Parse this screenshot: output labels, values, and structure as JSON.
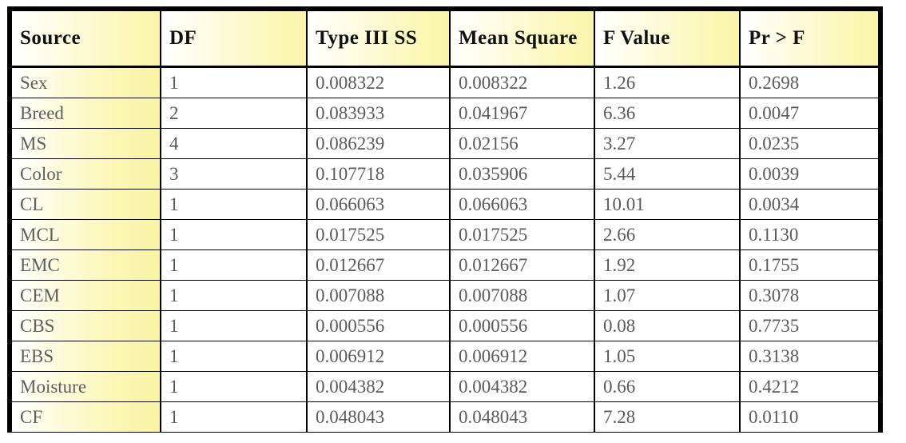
{
  "table": {
    "name": "anova-type-iii-table",
    "columns": [
      {
        "key": "source",
        "label": "Source"
      },
      {
        "key": "df",
        "label": "DF"
      },
      {
        "key": "ss",
        "label": "Type III SS"
      },
      {
        "key": "ms",
        "label": "Mean Square"
      },
      {
        "key": "f",
        "label": "F Value"
      },
      {
        "key": "p",
        "label": "Pr > F"
      }
    ],
    "rows": [
      {
        "source": "Sex",
        "df": "1",
        "ss": "0.008322",
        "ms": "0.008322",
        "f": "1.26",
        "p": "0.2698"
      },
      {
        "source": "Breed",
        "df": "2",
        "ss": "0.083933",
        "ms": "0.041967",
        "f": "6.36",
        "p": "0.0047"
      },
      {
        "source": "MS",
        "df": "4",
        "ss": "0.086239",
        "ms": "0.02156",
        "f": "3.27",
        "p": "0.0235"
      },
      {
        "source": "Color",
        "df": "3",
        "ss": "0.107718",
        "ms": "0.035906",
        "f": "5.44",
        "p": "0.0039"
      },
      {
        "source": "CL",
        "df": "1",
        "ss": "0.066063",
        "ms": "0.066063",
        "f": "10.01",
        "p": "0.0034"
      },
      {
        "source": "MCL",
        "df": "1",
        "ss": "0.017525",
        "ms": "0.017525",
        "f": "2.66",
        "p": "0.1130"
      },
      {
        "source": "EMC",
        "df": "1",
        "ss": "0.012667",
        "ms": "0.012667",
        "f": "1.92",
        "p": "0.1755"
      },
      {
        "source": "CEM",
        "df": "1",
        "ss": "0.007088",
        "ms": "0.007088",
        "f": "1.07",
        "p": "0.3078"
      },
      {
        "source": "CBS",
        "df": "1",
        "ss": "0.000556",
        "ms": "0.000556",
        "f": "0.08",
        "p": "0.7735"
      },
      {
        "source": "EBS",
        "df": "1",
        "ss": "0.006912",
        "ms": "0.006912",
        "f": "1.05",
        "p": "0.3138"
      },
      {
        "source": "Moisture",
        "df": "1",
        "ss": "0.004382",
        "ms": "0.004382",
        "f": "0.66",
        "p": "0.4212"
      },
      {
        "source": "CF",
        "df": "1",
        "ss": "0.048043",
        "ms": "0.048043",
        "f": "7.28",
        "p": "0.0110"
      }
    ]
  },
  "colors": {
    "border": "#000000",
    "header_gradient_start": "#ffffff",
    "header_gradient_end": "#faf5ab",
    "body_text": "#5a5a5a",
    "header_text": "#111111",
    "page_background": "#ffffff"
  }
}
